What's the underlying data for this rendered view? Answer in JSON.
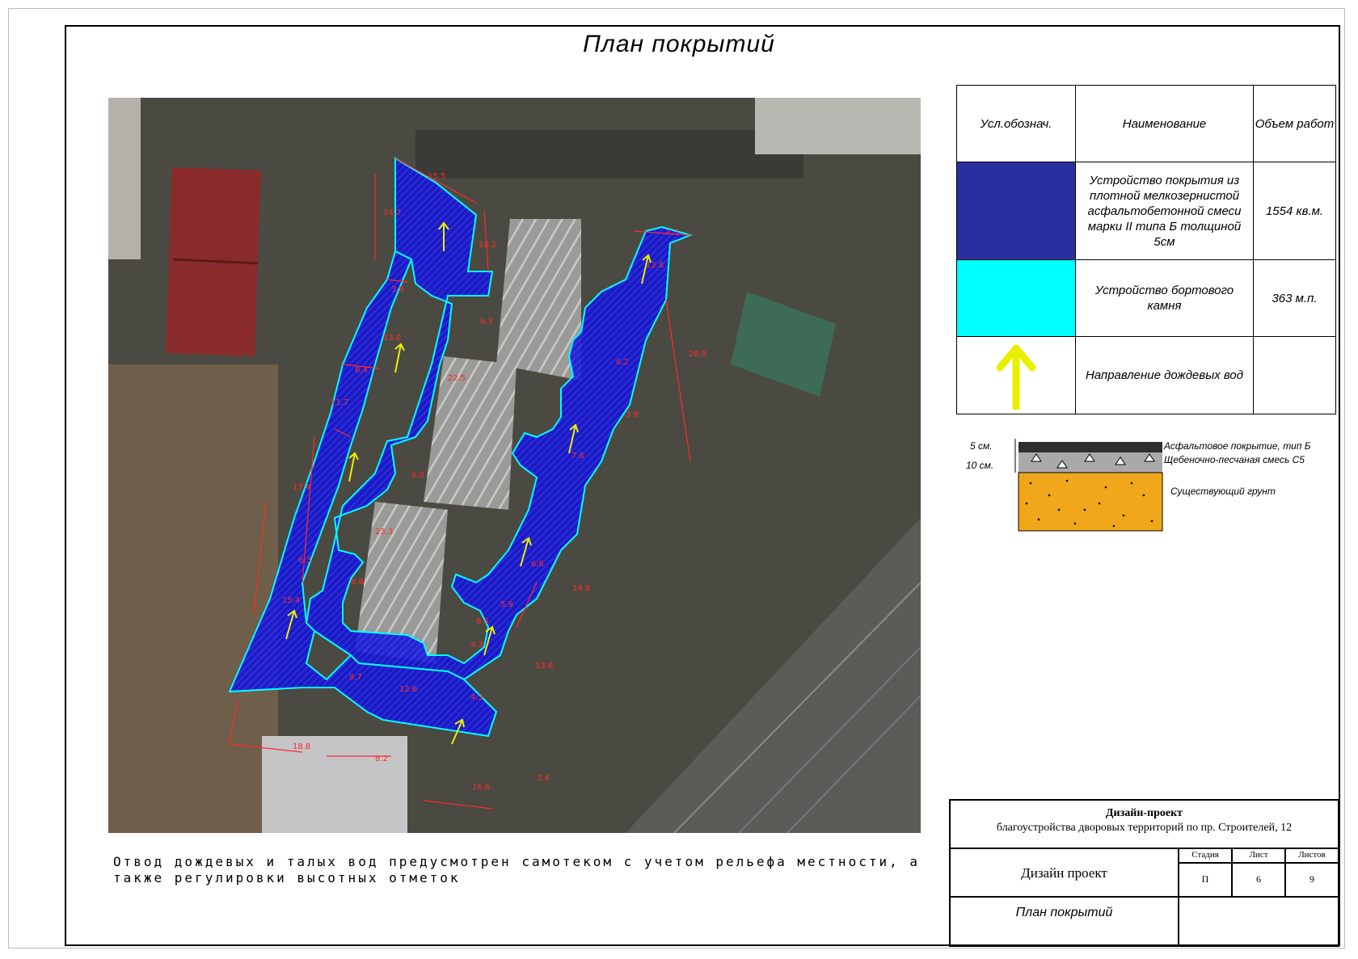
{
  "sheet": {
    "title": "План покрытий"
  },
  "legend": {
    "headers": {
      "symbol": "Усл.обознач.",
      "name": "Наименование",
      "volume": "Объем работ"
    },
    "rows": [
      {
        "swatch": "#2a2fa0",
        "name": "Устройство покрытия из плотной мелкозернистой асфальтобетонной смеси марки II типа Б толщиной 5см",
        "volume": "1554 кв.м."
      },
      {
        "swatch": "#00ffff",
        "name": "Устройство бортового камня",
        "volume": "363 м.п."
      },
      {
        "swatch": "arrow-up-yellow",
        "name": "Направление дождевых вод",
        "volume": ""
      }
    ]
  },
  "section": {
    "thickness_top": "5 см.",
    "thickness_bottom": "10 см.",
    "layer1": "Асфальтовое покрытие, тип Б",
    "layer2": "Щебеночно-песчаная смесь С5",
    "layer3": "Существующий грунт"
  },
  "notes": {
    "line1": "Отвод дождевых и талых вод предусмотрен самотеком с учетом рельефа местности, а",
    "line2": "также регулировки высотных отметок"
  },
  "title_block": {
    "project_title": "Дизайн-проект",
    "project_subtitle": "благоустройства дворовых территорий по пр. Строителей, 12",
    "stage_label": "Дизайн проект",
    "col_stage": "Стадия",
    "col_sheet": "Лист",
    "col_sheets": "Листов",
    "stage": "П",
    "sheet": "6",
    "sheets": "9",
    "drawing_name": "План покрытий"
  },
  "dimensions": [
    "15.5",
    "14.2",
    "10.2",
    "3.9",
    "13.0",
    "6.4",
    "6.3",
    "22.5",
    "11.7",
    "6.0",
    "17.4",
    "23.3",
    "6.3",
    "6.8",
    "15.4",
    "12.6",
    "7.6",
    "6.8",
    "13.6",
    "5.9",
    "4.3",
    "18.8",
    "8.2",
    "16.6",
    "3.4",
    "7.7",
    "12.8",
    "28.9",
    "9.7",
    "6.2",
    "14.8",
    "4.3",
    "6.5",
    "3.9"
  ],
  "colors": {
    "asphalt": "#2a2fa0",
    "curb": "#00ffff",
    "rain_arrow": "#e8f000",
    "dimension": "#ff2a2a"
  }
}
